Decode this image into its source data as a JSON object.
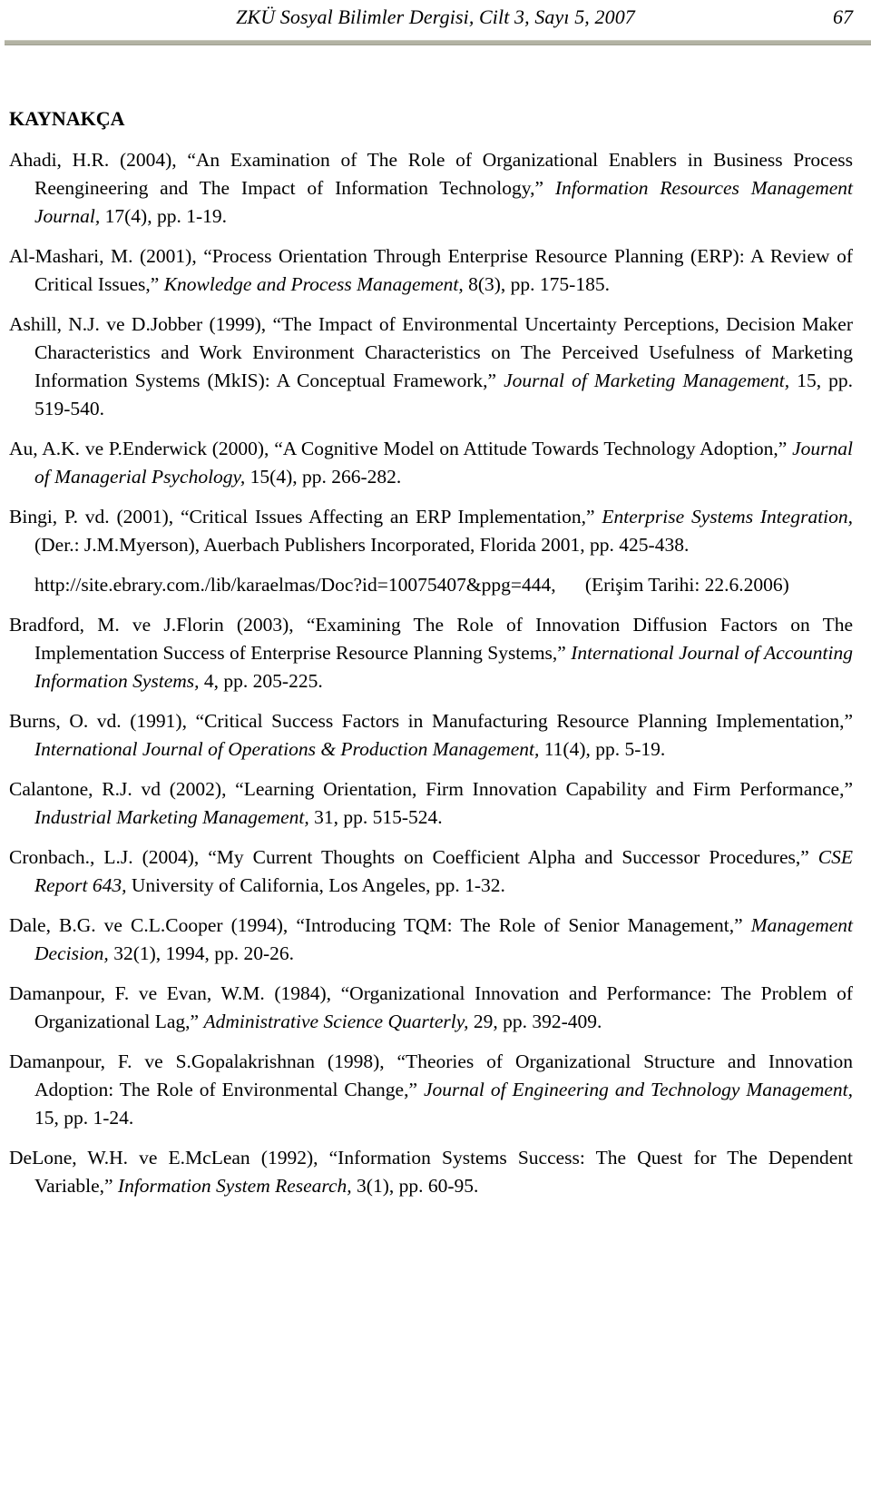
{
  "header": {
    "running_title": "ZKÜ Sosyal Bilimler Dergisi, Cilt 3, Sayı 5, 2007",
    "page_number": "67"
  },
  "section": {
    "heading": "KAYNAKÇA"
  },
  "references": [
    {
      "id": "ahadi-2004",
      "parts": [
        {
          "text": "Ahadi, H.R. (2004), “An Examination of The Role of Organizational Enablers in Business Process Reengineering and The Impact of Information Technology,” ",
          "style": "roman"
        },
        {
          "text": "Information Resources Management Journal,",
          "style": "italic"
        },
        {
          "text": " 17(4), pp. 1-19.",
          "style": "roman"
        }
      ]
    },
    {
      "id": "al-mashari-2001",
      "parts": [
        {
          "text": "Al-Mashari, M. (2001), “Process Orientation Through Enterprise Resource Planning (ERP): A Review of Critical Issues,” ",
          "style": "roman"
        },
        {
          "text": "Knowledge and Process Management,",
          "style": "italic"
        },
        {
          "text": " 8(3), pp. 175-185.",
          "style": "roman"
        }
      ]
    },
    {
      "id": "ashill-jobber-1999",
      "parts": [
        {
          "text": "Ashill, N.J. ve D.Jobber (1999), “The Impact of Environmental Uncertainty Perceptions, Decision Maker Characteristics and Work Environment Characteristics on The Perceived Usefulness of Marketing Information Systems (MkIS): A Conceptual Framework,” ",
          "style": "roman"
        },
        {
          "text": "Journal of Marketing Management,",
          "style": "italic"
        },
        {
          "text": " 15, pp. 519-540.",
          "style": "roman"
        }
      ]
    },
    {
      "id": "au-enderwick-2000",
      "parts": [
        {
          "text": "Au, A.K. ve P.Enderwick (2000), “A Cognitive Model on Attitude Towards Technology Adoption,” ",
          "style": "roman"
        },
        {
          "text": "Journal of Managerial Psychology,",
          "style": "italic"
        },
        {
          "text": " 15(4), pp. 266-282.",
          "style": "roman"
        }
      ]
    },
    {
      "id": "bingi-2001",
      "parts": [
        {
          "text": "Bingi, P. vd. (2001), “Critical Issues Affecting an ERP Implementation,” ",
          "style": "roman"
        },
        {
          "text": "Enterprise Systems Integration,",
          "style": "italic"
        },
        {
          "text": " (Der.: J.M.Myerson), Auerbach Publishers Incorporated, Florida 2001, pp. 425-438.",
          "style": "roman"
        }
      ]
    },
    {
      "id": "ebrary-url",
      "indented": true,
      "parts": [
        {
          "text": "http://site.ebrary.com./lib/karaelmas/Doc?id=10075407&ppg=444,  (Erişim Tarihi: 22.6.2006)",
          "style": "roman"
        }
      ]
    },
    {
      "id": "bradford-florin-2003",
      "parts": [
        {
          "text": "Bradford, M. ve J.Florin (2003), “Examining The Role of Innovation Diffusion Factors on The Implementation Success of Enterprise Resource Planning Systems,” ",
          "style": "roman"
        },
        {
          "text": "International Journal of Accounting Information Systems,",
          "style": "italic"
        },
        {
          "text": " 4, pp. 205-225.",
          "style": "roman"
        }
      ]
    },
    {
      "id": "burns-1991",
      "parts": [
        {
          "text": "Burns, O. vd. (1991), “Critical Success Factors in Manufacturing Resource Planning Implementation,” ",
          "style": "roman"
        },
        {
          "text": "International Journal of Operations & Production Management,",
          "style": "italic"
        },
        {
          "text": " 11(4), pp. 5-19.",
          "style": "roman"
        }
      ]
    },
    {
      "id": "calantone-2002",
      "parts": [
        {
          "text": "Calantone, R.J. vd (2002), “Learning Orientation, Firm Innovation Capability and Firm Performance,” ",
          "style": "roman"
        },
        {
          "text": "Industrial Marketing Management,",
          "style": "italic"
        },
        {
          "text": " 31, pp. 515-524.",
          "style": "roman"
        }
      ]
    },
    {
      "id": "cronbach-2004",
      "parts": [
        {
          "text": "Cronbach., L.J. (2004), “My Current Thoughts on Coefficient Alpha and Successor Procedures,” ",
          "style": "roman"
        },
        {
          "text": "CSE Report 643,",
          "style": "italic"
        },
        {
          "text": " University of California, Los Angeles, pp. 1-32.",
          "style": "roman"
        }
      ]
    },
    {
      "id": "dale-cooper-1994",
      "parts": [
        {
          "text": "Dale, B.G. ve C.L.Cooper (1994), “Introducing TQM: The Role of Senior Management,” ",
          "style": "roman"
        },
        {
          "text": "Management Decision,",
          "style": "italic"
        },
        {
          "text": " 32(1), 1994, pp. 20-26.",
          "style": "roman"
        }
      ]
    },
    {
      "id": "damanpour-evan-1984",
      "parts": [
        {
          "text": "Damanpour, F. ve Evan, W.M. (1984), “Organizational Innovation and Performance: The Problem of Organizational Lag,” ",
          "style": "roman"
        },
        {
          "text": "Administrative Science Quarterly,",
          "style": "italic"
        },
        {
          "text": " 29, pp. 392-409.",
          "style": "roman"
        }
      ]
    },
    {
      "id": "damanpour-gopalakrishnan-1998",
      "parts": [
        {
          "text": "Damanpour, F. ve S.Gopalakrishnan (1998), “Theories of Organizational Structure and Innovation Adoption: The Role of Environmental Change,” ",
          "style": "roman"
        },
        {
          "text": "Journal of Engineering and Technology Management,",
          "style": "italic"
        },
        {
          "text": " 15, pp. 1-24.",
          "style": "roman"
        }
      ]
    },
    {
      "id": "delone-mclean-1992",
      "parts": [
        {
          "text": "DeLone, W.H. ve E.McLean (1992), “Information Systems Success: The Quest for The Dependent Variable,” ",
          "style": "roman"
        },
        {
          "text": "Information System Research,",
          "style": "italic"
        },
        {
          "text": " 3(1), pp. 60-95.",
          "style": "roman"
        }
      ]
    }
  ],
  "colors": {
    "rule": "#b3b3a4",
    "text": "#000000",
    "background": "#ffffff"
  }
}
